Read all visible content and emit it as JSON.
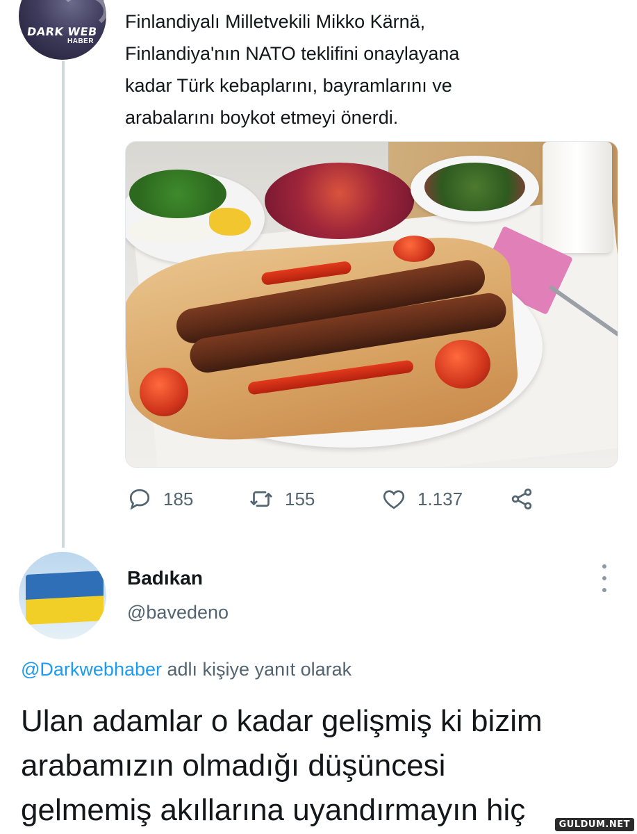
{
  "tweet": {
    "avatar_brand_line1": "DARK WEB",
    "avatar_brand_line2": "HABER",
    "text_lines": [
      "Finlandiyalı Milletvekili Mikko Kärnä,",
      "Finlandiya'nın NATO teklifini onaylayana",
      "kadar Türk kebaplarını, bayramlarını ve",
      "arabalarını boykot etmeyi önerdi."
    ],
    "photo_icon": "adana-kebab-photo",
    "actions": {
      "reply_count": "185",
      "retweet_count": "155",
      "like_count": "1.137",
      "reply_icon": "speech-bubble-icon",
      "retweet_icon": "retweet-icon",
      "like_icon": "heart-icon",
      "share_icon": "share-icon"
    }
  },
  "reply": {
    "display_name": "Badıkan",
    "handle": "@bavedeno",
    "replying_to_mention": "@Darkwebhaber",
    "replying_to_suffix": " adlı kişiye yanıt olarak",
    "text_lines": [
      "Ulan adamlar o kadar gelişmiş ki bizim",
      "arabamızın olmadığı düşüncesi",
      "gelmemiş akıllarına uyandırmayın hiç"
    ]
  },
  "watermark": "GULDUM.NET",
  "colors": {
    "text": "#14171a",
    "secondary": "#536471",
    "link": "#1d9bf0",
    "thread_line": "#cfd9de"
  }
}
